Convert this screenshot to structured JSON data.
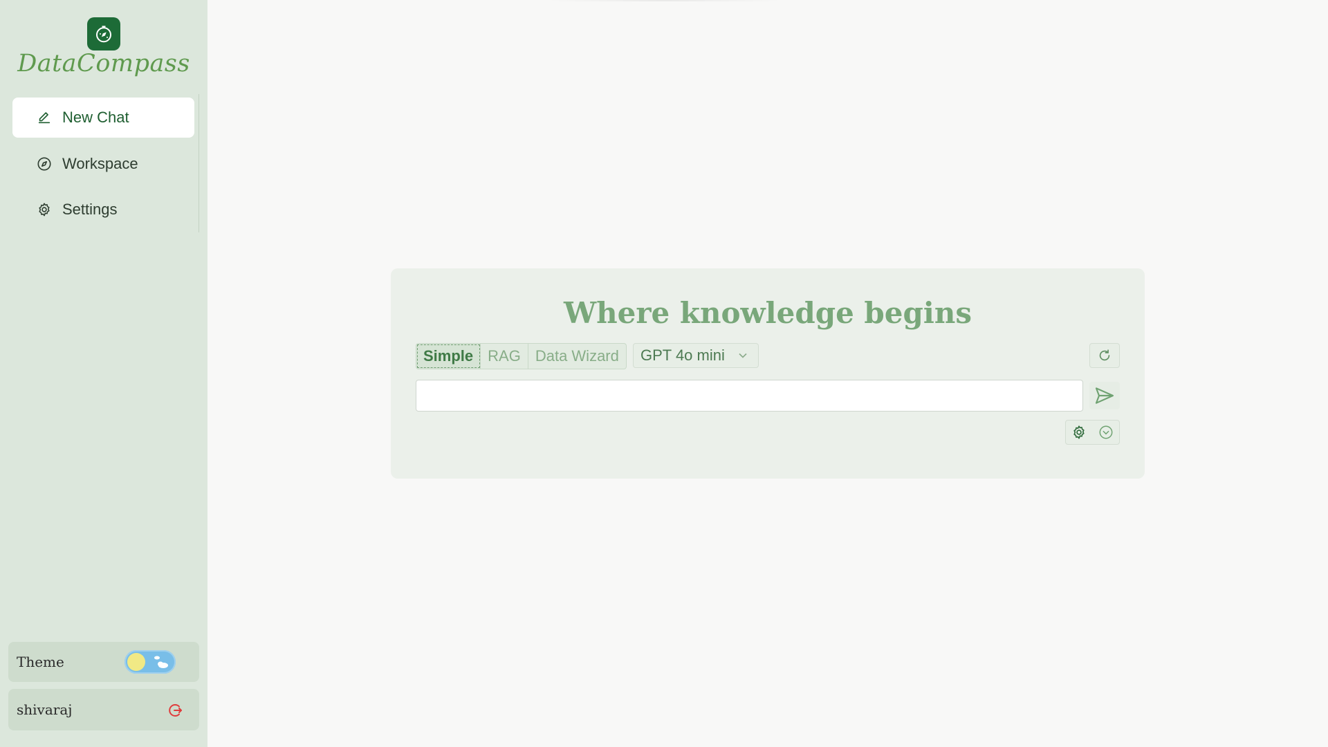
{
  "brand": {
    "name": "DataCompass",
    "logo_icon": "compass-icon"
  },
  "sidebar": {
    "items": [
      {
        "label": "New Chat",
        "icon": "pencil-icon",
        "active": true
      },
      {
        "label": "Workspace",
        "icon": "compass-icon",
        "active": false
      },
      {
        "label": "Settings",
        "icon": "gear-icon",
        "active": false
      }
    ],
    "theme_label": "Theme",
    "theme_mode": "light",
    "user_name": "shivaraj"
  },
  "main": {
    "headline": "Where knowledge begins",
    "modes": [
      "Simple",
      "RAG",
      "Data Wizard"
    ],
    "active_mode": "Simple",
    "model": "GPT 4o mini",
    "input_value": "",
    "input_placeholder": ""
  },
  "colors": {
    "sidebar_bg": "#dce7dc",
    "brand_green": "#1d6b37",
    "headline": "#79a77a",
    "accent": "#3f7a46",
    "logout_red": "#e03b3b"
  }
}
